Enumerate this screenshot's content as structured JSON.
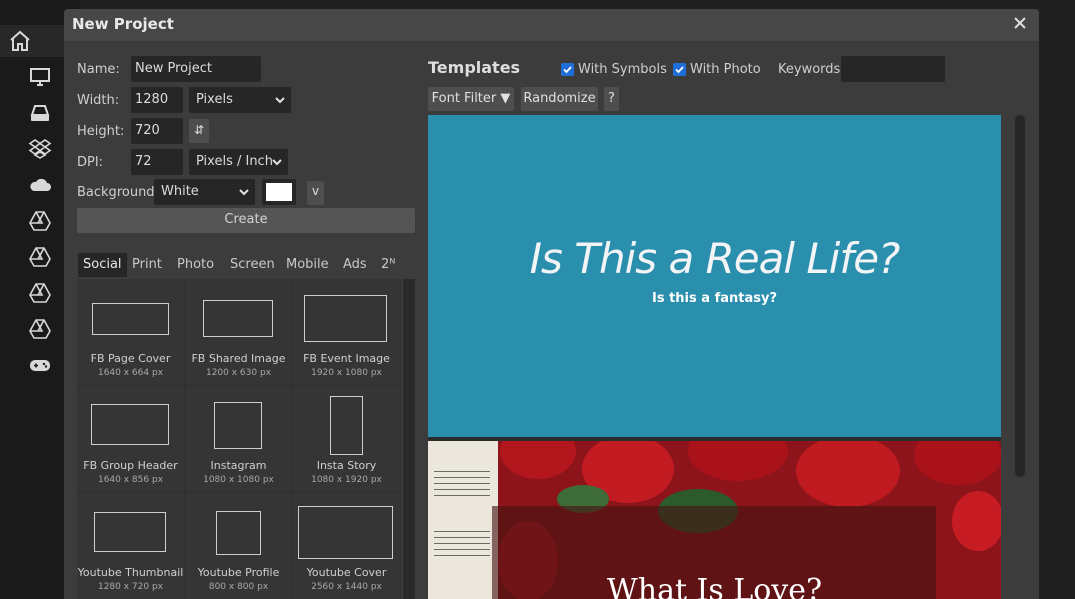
{
  "sidebar": {
    "icons": [
      "home-icon",
      "monitor-icon",
      "drive-icon",
      "dropbox-icon",
      "onedrive-icon",
      "google-drive-icon",
      "google-drive-icon",
      "google-drive-icon",
      "google-drive-icon",
      "gamepad-icon"
    ]
  },
  "dialog": {
    "title": "New Project",
    "close_label": "×"
  },
  "form": {
    "name_label": "Name:",
    "name_value": "New Project",
    "width_label": "Width:",
    "width_value": "1280",
    "width_unit": "Pixels",
    "height_label": "Height:",
    "height_value": "720",
    "swap_label": "⇵",
    "dpi_label": "DPI:",
    "dpi_value": "72",
    "dpi_unit": "Pixels / Inch",
    "background_label": "Background:",
    "background_value": "White",
    "background_color": "#ffffff",
    "v_label": "v",
    "create_label": "Create"
  },
  "tabs": [
    "Social",
    "Print",
    "Photo",
    "Screen",
    "Mobile",
    "Ads",
    "2ᴺ"
  ],
  "presets": [
    {
      "name": "FB Page Cover",
      "size": "1640 x 664 px"
    },
    {
      "name": "FB Shared Image",
      "size": "1200 x 630 px"
    },
    {
      "name": "FB Event Image",
      "size": "1920 x 1080 px"
    },
    {
      "name": "FB Group Header",
      "size": "1640 x 856 px"
    },
    {
      "name": "Instagram",
      "size": "1080 x 1080 px"
    },
    {
      "name": "Insta Story",
      "size": "1080 x 1920 px"
    },
    {
      "name": "Youtube Thumbnail",
      "size": "1280 x 720 px"
    },
    {
      "name": "Youtube Profile",
      "size": "800 x 800 px"
    },
    {
      "name": "Youtube Cover",
      "size": "2560 x 1440 px"
    }
  ],
  "templates": {
    "title": "Templates",
    "with_symbols": "With Symbols",
    "with_symbols_checked": true,
    "with_photo": "With Photo",
    "with_photo_checked": true,
    "keywords_label": "Keywords:",
    "keywords_value": "",
    "font_filter": "Font Filter ▼",
    "randomize": "Randomize",
    "help": "?",
    "cards": [
      {
        "title": "Is This a Real Life?",
        "subtitle": "Is this a fantasy?",
        "background": "#2a8ead"
      },
      {
        "title": "What Is Love?"
      }
    ]
  },
  "colors": {
    "accent_blue": "#1e6fd9",
    "dialog_bg": "#3c3c3c",
    "input_bg": "#262626"
  }
}
